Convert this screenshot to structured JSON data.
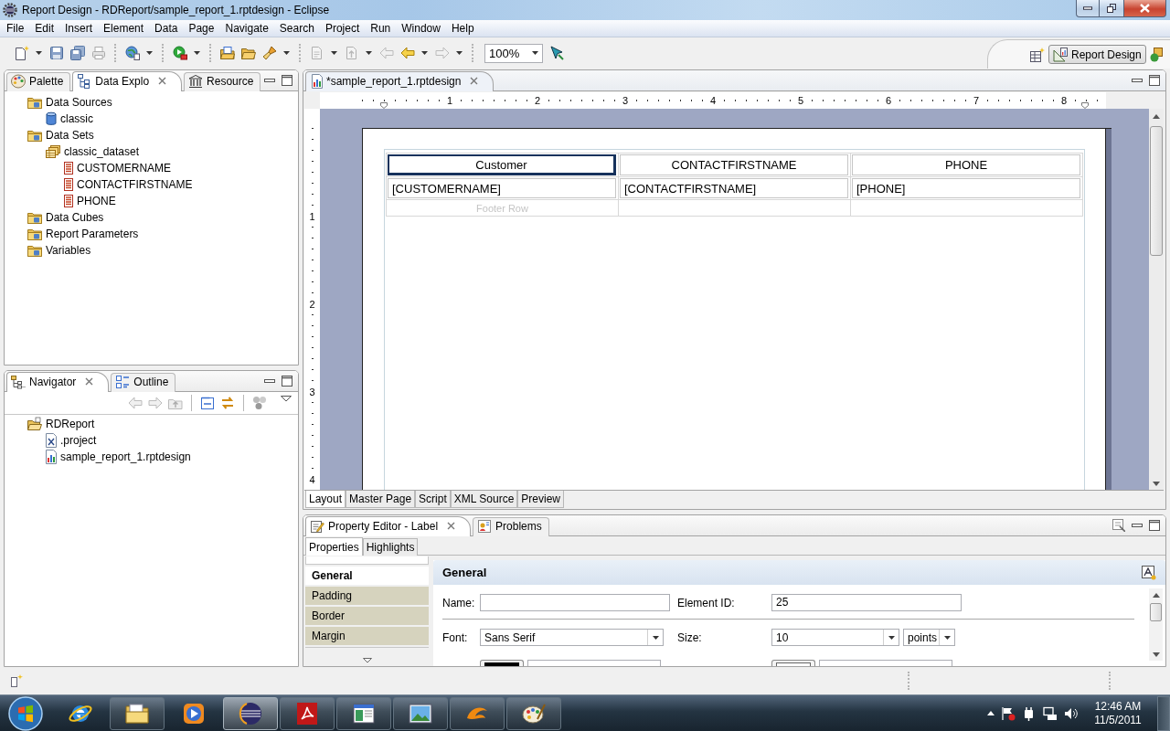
{
  "window": {
    "title": "Report Design - RDReport/sample_report_1.rptdesign - Eclipse"
  },
  "menu": [
    "File",
    "Edit",
    "Insert",
    "Element",
    "Data",
    "Page",
    "Navigate",
    "Search",
    "Project",
    "Run",
    "Window",
    "Help"
  ],
  "toolbar": {
    "zoom": "100%"
  },
  "perspectives": [
    {
      "label": "Report Design",
      "selected": true
    }
  ],
  "data_explorer": {
    "tabs": [
      {
        "label": "Palette",
        "kind": "palette",
        "selected": false
      },
      {
        "label": "Data Explo",
        "kind": "data",
        "selected": true
      },
      {
        "label": "Resource",
        "kind": "resource",
        "selected": false
      }
    ],
    "tree": [
      {
        "label": "Data Sources",
        "kind": "folder",
        "children": [
          {
            "label": "classic",
            "kind": "data-source"
          }
        ]
      },
      {
        "label": "Data Sets",
        "kind": "folder",
        "children": [
          {
            "label": "classic_dataset",
            "kind": "data-set",
            "children": [
              {
                "label": "CUSTOMERNAME",
                "kind": "column"
              },
              {
                "label": "CONTACTFIRSTNAME",
                "kind": "column"
              },
              {
                "label": "PHONE",
                "kind": "column"
              }
            ]
          }
        ]
      },
      {
        "label": "Data Cubes",
        "kind": "folder"
      },
      {
        "label": "Report Parameters",
        "kind": "folder"
      },
      {
        "label": "Variables",
        "kind": "folder"
      }
    ]
  },
  "navigator": {
    "tabs": [
      {
        "label": "Navigator",
        "kind": "navigator",
        "selected": true
      },
      {
        "label": "Outline",
        "kind": "outline",
        "selected": false
      }
    ],
    "tree": [
      {
        "label": "RDReport",
        "kind": "project",
        "children": [
          {
            "label": ".project",
            "kind": "xml-file"
          },
          {
            "label": "sample_report_1.rptdesign",
            "kind": "report-file"
          }
        ]
      }
    ]
  },
  "editor": {
    "tabs": [
      {
        "label": "*sample_report_1.rptdesign",
        "selected": true
      }
    ],
    "ruler": {
      "horizontal": [
        "1",
        "2",
        "3",
        "4",
        "5",
        "6",
        "7",
        "8"
      ],
      "vertical": [
        "1",
        "2",
        "3",
        "4"
      ]
    },
    "table": {
      "header": [
        {
          "text": "Customer",
          "selected": true
        },
        {
          "text": "CONTACTFIRSTNAME",
          "selected": false
        },
        {
          "text": "PHONE",
          "selected": false
        }
      ],
      "detail": [
        "[CUSTOMERNAME]",
        "[CONTACTFIRSTNAME]",
        "[PHONE]"
      ],
      "footer": "Footer Row"
    },
    "bottom_tabs": [
      {
        "label": "Layout",
        "selected": true
      },
      {
        "label": "Master Page",
        "selected": false
      },
      {
        "label": "Script",
        "selected": false
      },
      {
        "label": "XML Source",
        "selected": false
      },
      {
        "label": "Preview",
        "selected": false
      }
    ]
  },
  "property_editor": {
    "tabs": [
      {
        "label": "Property Editor - Label",
        "kind": "properties",
        "selected": true
      },
      {
        "label": "Problems",
        "kind": "problems",
        "selected": false
      }
    ],
    "subtabs": [
      {
        "label": "Properties",
        "selected": true
      },
      {
        "label": "Highlights",
        "selected": false
      }
    ],
    "categories": [
      {
        "label": "General",
        "selected": true
      },
      {
        "label": "Padding",
        "selected": false
      },
      {
        "label": "Border",
        "selected": false
      },
      {
        "label": "Margin",
        "selected": false
      }
    ],
    "section": "General",
    "fields": [
      {
        "label": "Name:",
        "kind": "text"
      },
      {
        "label": "Element ID:",
        "kind": "text",
        "value": "25"
      },
      {
        "label": "Font:",
        "kind": "combo",
        "value": "Sans Serif"
      },
      {
        "label": "Size:",
        "kind": "combo",
        "value": "10",
        "unit": "points"
      }
    ]
  },
  "taskbar": {
    "apps": [
      {
        "kind": "browser",
        "running": false,
        "selected": false
      },
      {
        "kind": "folder",
        "running": true,
        "selected": false
      },
      {
        "kind": "media",
        "running": false,
        "selected": false
      },
      {
        "kind": "eclipse",
        "running": true,
        "selected": true
      },
      {
        "kind": "pdf",
        "running": true,
        "selected": false
      },
      {
        "kind": "window",
        "running": true,
        "selected": false
      },
      {
        "kind": "picture",
        "running": true,
        "selected": false
      },
      {
        "kind": "swirl",
        "running": true,
        "selected": false
      },
      {
        "kind": "palette",
        "running": true,
        "selected": false
      }
    ],
    "time": "12:46 AM",
    "date": "11/5/2011"
  }
}
